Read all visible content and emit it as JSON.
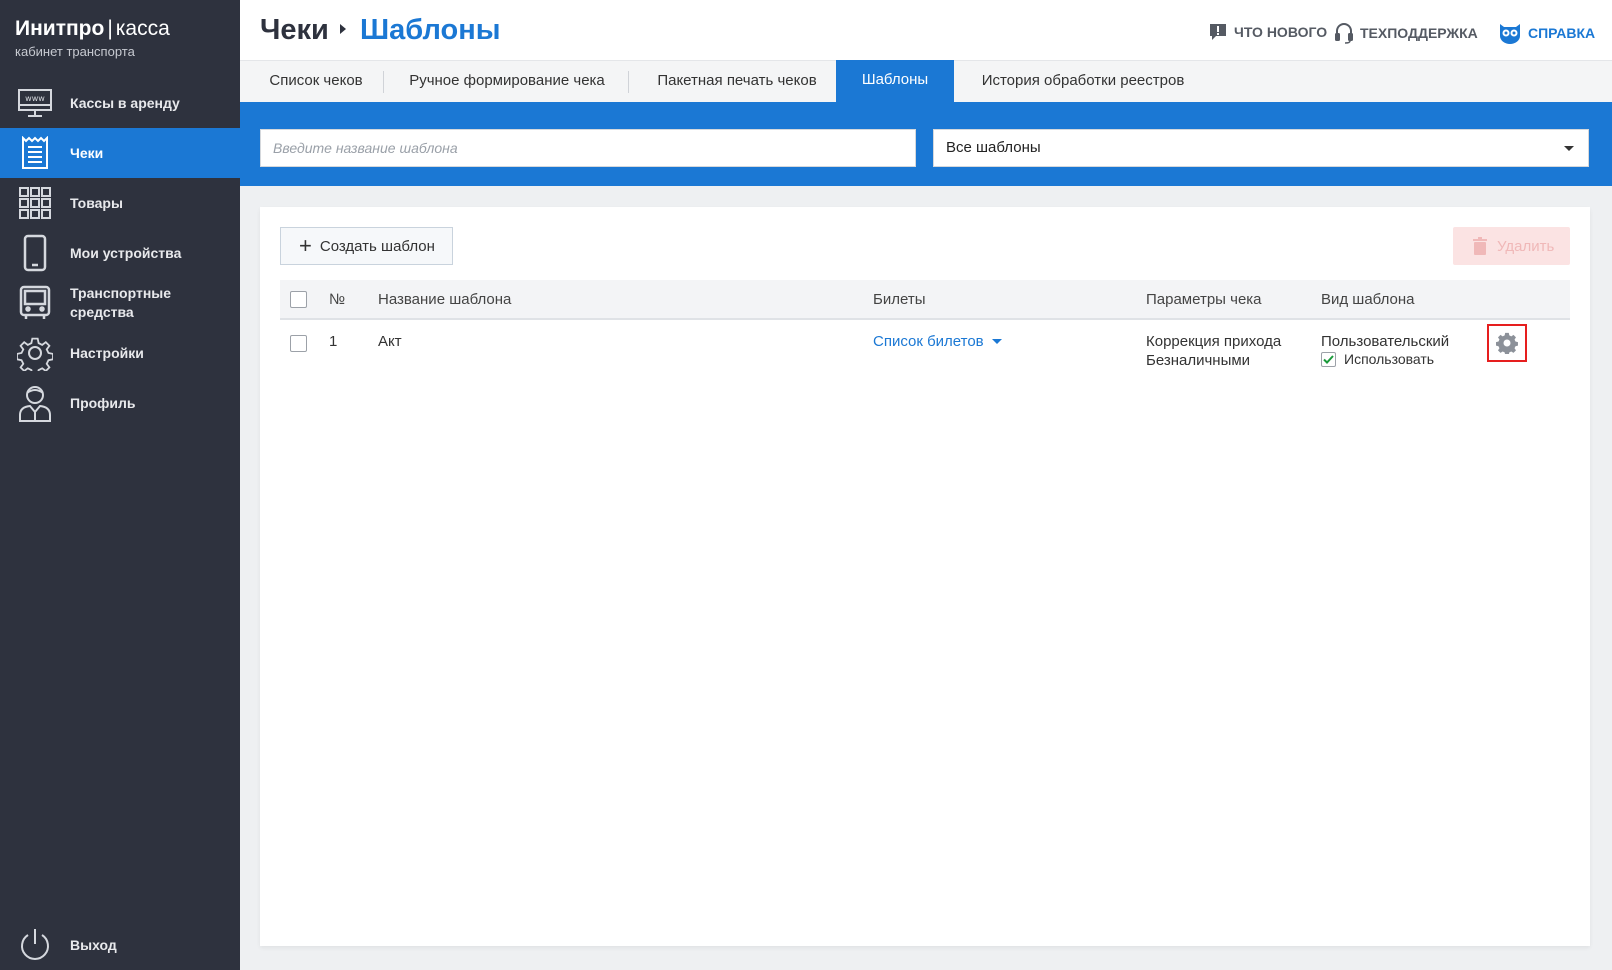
{
  "brand": {
    "name_bold": "Инитпро",
    "separator": "|",
    "name_light": "касса",
    "subtitle": "кабинет транспорта"
  },
  "sidebar": {
    "items": [
      {
        "label": "Кассы в аренду",
        "icon": "www-monitor-icon",
        "active": false
      },
      {
        "label": "Чеки",
        "icon": "receipt-icon",
        "active": true
      },
      {
        "label": "Товары",
        "icon": "grid-icon",
        "active": false
      },
      {
        "label": "Мои устройства",
        "icon": "phone-icon",
        "active": false
      },
      {
        "label": "Транспортные средства",
        "icon": "bus-icon",
        "active": false
      },
      {
        "label": "Настройки",
        "icon": "gear-icon",
        "active": false
      },
      {
        "label": "Профиль",
        "icon": "user-icon",
        "active": false
      }
    ],
    "logout_label": "Выход"
  },
  "header": {
    "breadcrumb_root": "Чеки",
    "breadcrumb_current": "Шаблоны",
    "links": [
      {
        "label": "ЧТО НОВОГО",
        "icon": "announcement-icon"
      },
      {
        "label": "ТЕХПОДДЕРЖКА",
        "icon": "headset-icon"
      },
      {
        "label": "СПРАВКА",
        "icon": "owl-icon"
      }
    ]
  },
  "tabs": [
    {
      "label": "Список чеков",
      "active": false
    },
    {
      "label": "Ручное формирование чека",
      "active": false
    },
    {
      "label": "Пакетная печать чеков",
      "active": false
    },
    {
      "label": "Шаблоны",
      "active": true
    },
    {
      "label": "История обработки реестров",
      "active": false
    }
  ],
  "filters": {
    "search_placeholder": "Введите название шаблона",
    "search_value": "",
    "type_select": "Все шаблоны"
  },
  "toolbar": {
    "create_label": "Создать шаблон",
    "delete_label": "Удалить"
  },
  "table": {
    "headers": {
      "number": "№",
      "name": "Название шаблона",
      "tickets": "Билеты",
      "params": "Параметры чека",
      "kind": "Вид шаблона"
    },
    "rows": [
      {
        "number": "1",
        "name": "Акт",
        "tickets_link": "Список билетов",
        "params_line1": "Коррекция прихода",
        "params_line2": "Безналичными",
        "kind": "Пользовательский",
        "use_label": "Использовать",
        "use_checked": true
      }
    ]
  },
  "colors": {
    "accent": "#1b78d4",
    "sidebar_bg": "#2e323e",
    "highlight": "#e61e1e"
  }
}
